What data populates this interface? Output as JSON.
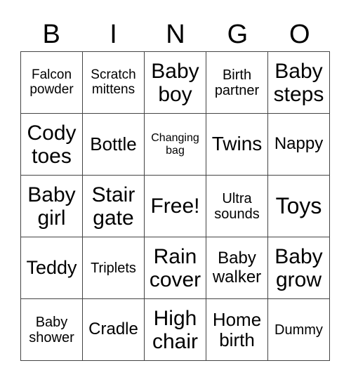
{
  "header": [
    "B",
    "I",
    "N",
    "G",
    "O"
  ],
  "cells": [
    [
      "Falcon powder",
      "Scratch mittens",
      "Baby boy",
      "Birth partner",
      "Baby steps"
    ],
    [
      "Cody toes",
      "Bottle",
      "Changing bag",
      "Twins",
      "Nappy"
    ],
    [
      "Baby girl",
      "Stair gate",
      "Free!",
      "Ultra sounds",
      "Toys"
    ],
    [
      "Teddy",
      "Triplets",
      "Rain cover",
      "Baby walker",
      "Baby grow"
    ],
    [
      "Baby shower",
      "Cradle",
      "High chair",
      "Home birth",
      "Dummy"
    ]
  ]
}
